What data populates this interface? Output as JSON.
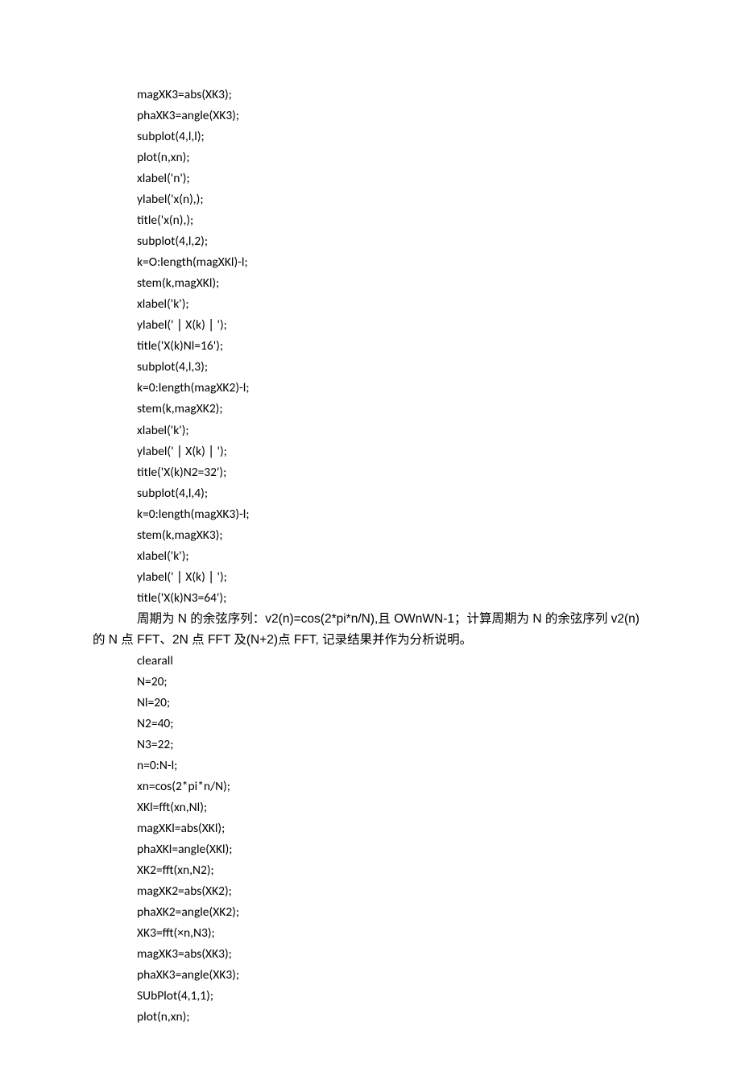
{
  "code1": [
    "magXK3=abs(XK3);",
    "phaXK3=angle(XK3);",
    "subplot(4,l,l);",
    "plot(n,xn);",
    "xlabel('n');",
    "ylabel('x(n),);",
    "title('x(n),);",
    "subplot(4,l,2);",
    "k=O:length(magXKl)-l;",
    "stem(k,magXKl);",
    "xlabel('k');",
    "ylabel(' ∣ X(k) ∣ ');",
    "title('X(k)Nl=16');",
    "subplot(4,l,3);",
    "k=0:length(magXK2)-l;",
    "stem(k,magXK2);",
    "xlabel('k');",
    "ylabel(' ∣ X(k) ∣ ');",
    "title('X(k)N2=32');",
    "subplot(4,l,4);",
    "k=0:length(magXK3)-l;",
    "stem(k,magXK3);",
    "xlabel('k');",
    "ylabel(' ∣ X(k) ∣ ');",
    "title('X(k)N3=64');"
  ],
  "paragraph": {
    "line1": "周期为 N 的余弦序列：v2(n)=cos(2*pi*n/N),且 OWnWN-1；计算周期为 N 的余弦序列 v2(n)",
    "line2": "的 N 点 FFT、2N 点 FFT 及(N+2)点 FFT, 记录结果并作为分析说明。"
  },
  "code2": [
    "clearall",
    "N=20;",
    "Nl=20;",
    "N2=40;",
    "N3=22;",
    "n=0:N-l;",
    "xn=cos(2*pi*n/N);",
    "XKl=fft(xn,Nl);",
    "magXKl=abs(XKl);",
    "phaXKl=angle(XKl);",
    "XK2=fft(xn,N2);",
    "magXK2=abs(XK2);",
    "phaXK2=angle(XK2);",
    "XK3=fft(×n,N3);",
    "magXK3=abs(XK3);",
    "phaXK3=angle(XK3);",
    "SUbPlot(4,1,1);",
    "plot(n,xn);"
  ]
}
